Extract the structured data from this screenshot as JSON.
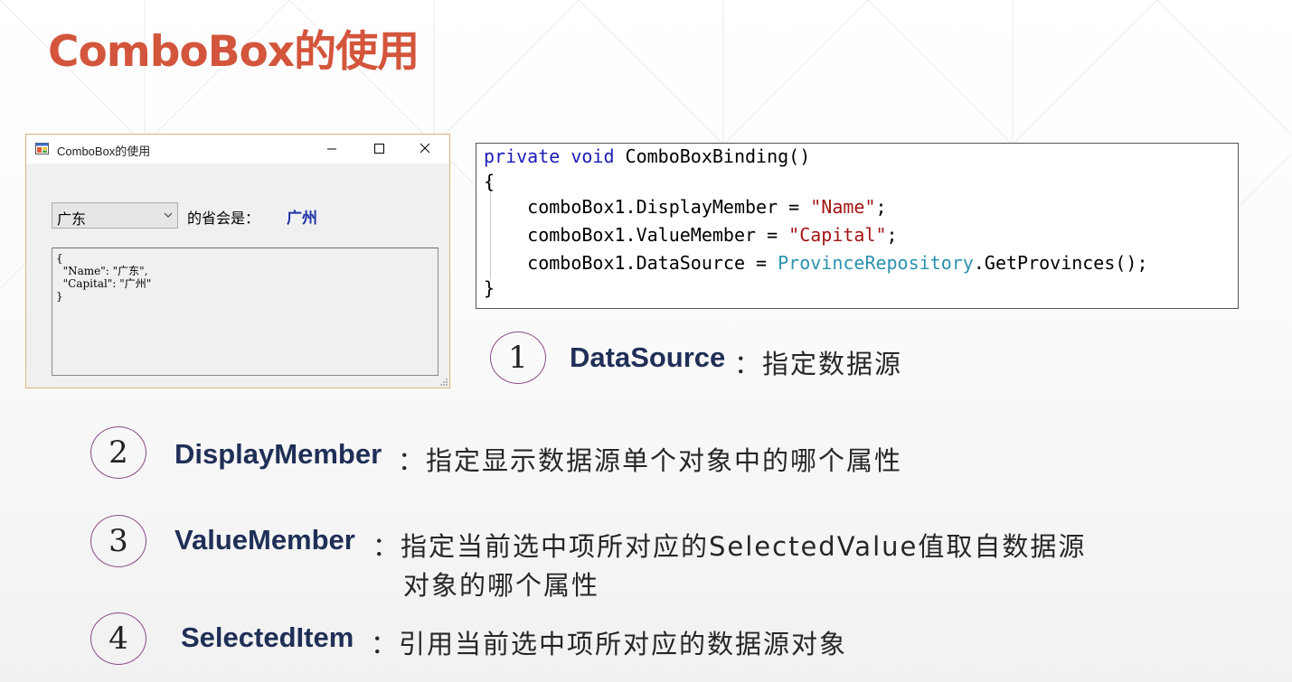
{
  "slide": {
    "title": "ComboBox的使用"
  },
  "window": {
    "title": "ComboBox的使用",
    "combo_value": "广东",
    "capital_label": "的省会是：",
    "capital_value": "广州",
    "json_text": "{\n  \"Name\": \"广东\",\n  \"Capital\": \"广州\"\n}"
  },
  "code": {
    "line1": {
      "kw": "private void",
      "rest": " ComboBoxBinding()"
    },
    "line2": "{",
    "line3": {
      "pre": "    comboBox1.DisplayMember = ",
      "str": "\"Name\"",
      "post": ";"
    },
    "line4": {
      "pre": "    comboBox1.ValueMember = ",
      "str": "\"Capital\"",
      "post": ";"
    },
    "line5": {
      "pre": "    comboBox1.DataSource = ",
      "typ": "ProvinceRepository",
      "post": ".GetProvinces();"
    },
    "line6": "}"
  },
  "items": [
    {
      "num": "1",
      "term": "DataSource",
      "desc": "：指定数据源"
    },
    {
      "num": "2",
      "term": "DisplayMember",
      "desc": "：指定显示数据源单个对象中的哪个属性"
    },
    {
      "num": "3",
      "term": "ValueMember",
      "desc": "：指定当前选中项所对应的SelectedValue值取自数据源",
      "desc2": "对象的哪个属性"
    },
    {
      "num": "4",
      "term": "SelectedItem",
      "desc": "：引用当前选中项所对应的数据源对象"
    }
  ],
  "colors": {
    "title": "#d3553c",
    "term": "#1f2f57",
    "circle": "#8a4a86",
    "keyword": "#1b1bb8",
    "string": "#a31515",
    "type": "#2b91af"
  }
}
